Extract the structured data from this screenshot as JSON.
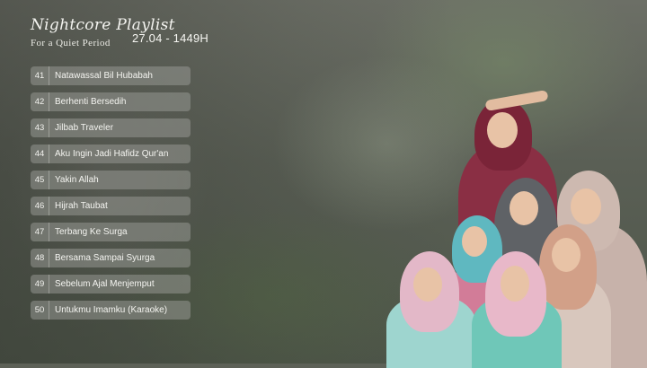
{
  "header": {
    "title": "Nightcore Playlist",
    "subtitle": "For a Quiet Period",
    "date": "27.04 - 1449H"
  },
  "playlist": [
    {
      "number": "41",
      "title": "Natawassal Bil Hubabah"
    },
    {
      "number": "42",
      "title": "Berhenti Bersedih"
    },
    {
      "number": "43",
      "title": "Jilbab Traveler"
    },
    {
      "number": "44",
      "title": "Aku Ingin Jadi Hafidz Qur'an"
    },
    {
      "number": "45",
      "title": "Yakin Allah"
    },
    {
      "number": "46",
      "title": "Hijrah Taubat"
    },
    {
      "number": "47",
      "title": "Terbang Ke Surga"
    },
    {
      "number": "48",
      "title": "Bersama Sampai Syurga"
    },
    {
      "number": "49",
      "title": "Sebelum Ajal Menjemput"
    },
    {
      "number": "50",
      "title": "Untukmu Imamku (Karaoke)"
    }
  ],
  "colors": {
    "row_background": "#9698928c",
    "text": "#f4f4f0"
  }
}
